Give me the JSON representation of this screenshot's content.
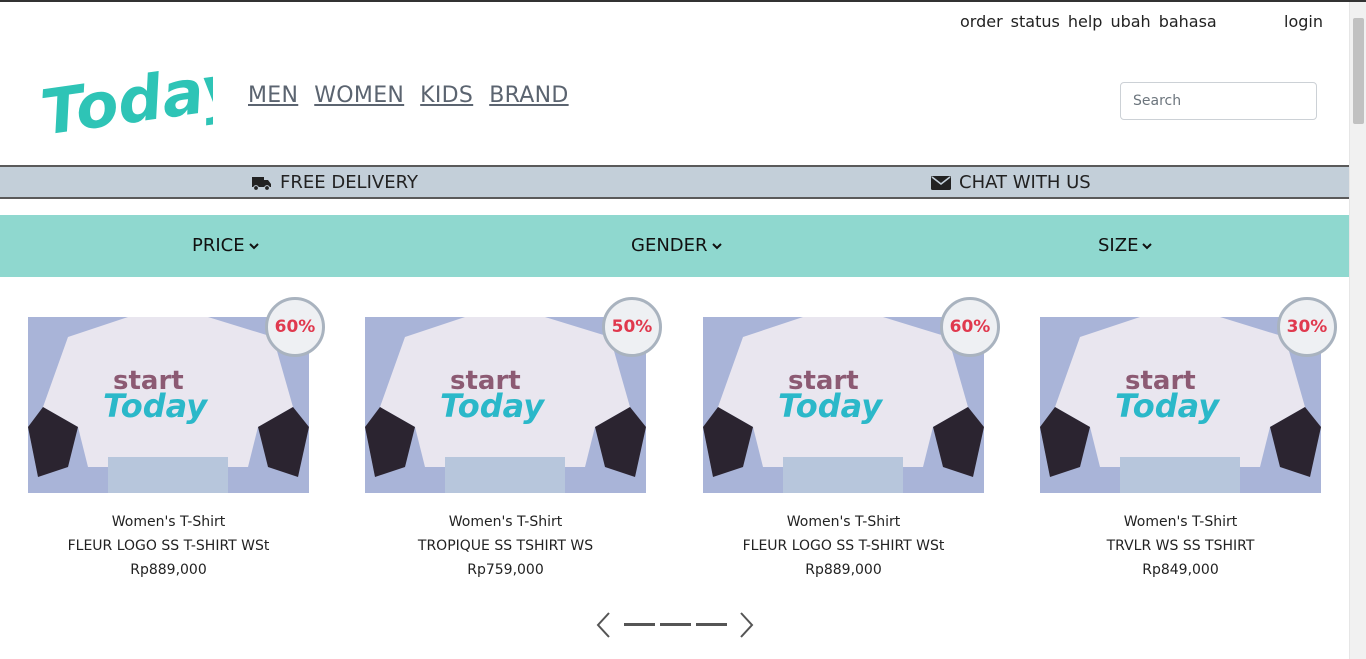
{
  "header": {
    "top_links": [
      "order",
      "status",
      "help",
      "ubah",
      "bahasa"
    ],
    "login": "login",
    "logo_text": "Today",
    "nav": [
      "MEN",
      "WOMEN",
      "KIDS",
      "BRAND"
    ],
    "search_placeholder": "Search"
  },
  "info_bar": {
    "delivery": "FREE DELIVERY",
    "chat": "CHAT WITH US",
    "delivery_icon": "truck-icon",
    "chat_icon": "envelope-icon"
  },
  "filters": {
    "price": "PRICE",
    "gender": "GENDER",
    "size": "SIZE",
    "icon": "chevron-down-icon"
  },
  "products": [
    {
      "discount": "60%",
      "category": "Women's T-Shirt",
      "name": "FLEUR LOGO SS T-SHIRT WSt",
      "price": "Rp889,000"
    },
    {
      "discount": "50%",
      "category": "Women's T-Shirt",
      "name": "TROPIQUE SS TSHIRT WS",
      "price": "Rp759,000"
    },
    {
      "discount": "60%",
      "category": "Women's T-Shirt",
      "name": "FLEUR LOGO SS T-SHIRT WSt",
      "price": "Rp889,000"
    },
    {
      "discount": "30%",
      "category": "Women's T-Shirt",
      "name": "TRVLR WS SS TSHIRT",
      "price": "Rp849,000"
    }
  ],
  "colors": {
    "brand_teal": "#2ec4b6",
    "filter_bar": "#8fd8cf",
    "info_bar": "#c3cfd9",
    "discount_text": "#e0394e"
  }
}
